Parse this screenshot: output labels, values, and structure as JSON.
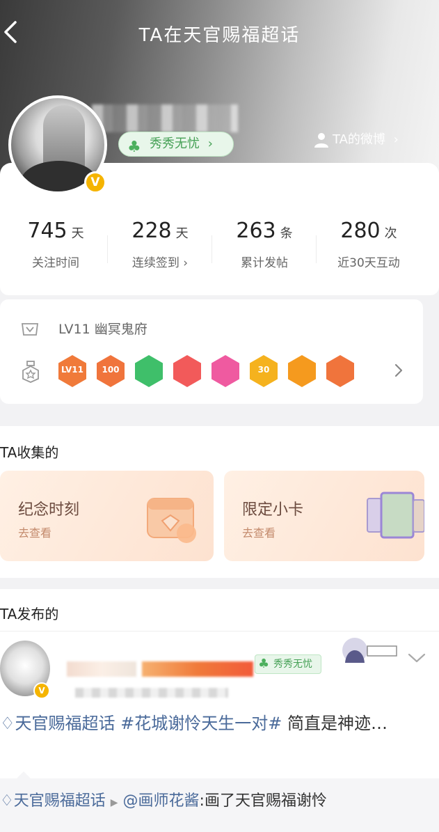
{
  "header": {
    "title": "TA在天官赐福超话",
    "fan_badge": "秀秀无忧",
    "weibo_link": "TA的微博"
  },
  "stats": [
    {
      "value": "745",
      "unit": "天",
      "label": "关注时间"
    },
    {
      "value": "228",
      "unit": "天",
      "label": "连续签到"
    },
    {
      "value": "263",
      "unit": "条",
      "label": "累计发帖"
    },
    {
      "value": "280",
      "unit": "次",
      "label": "近30天互动"
    }
  ],
  "level": {
    "text": "LV11 幽冥鬼府",
    "badges": [
      {
        "name": "lv11-badge",
        "label": "LV11",
        "color": "#f07a3a"
      },
      {
        "name": "100-days-badge",
        "label": "100",
        "color": "#f0743c"
      },
      {
        "name": "hand-badge",
        "label": "",
        "color": "#3fbf6a"
      },
      {
        "name": "trophy-badge",
        "label": "",
        "color": "#f25a5a"
      },
      {
        "name": "cap-badge",
        "label": "",
        "color": "#ef5aa0"
      },
      {
        "name": "30-days-badge",
        "label": "30",
        "color": "#f5b21e"
      },
      {
        "name": "face-badge",
        "label": "",
        "color": "#f59a1e"
      },
      {
        "name": "rock-badge",
        "label": "",
        "color": "#f0743c"
      }
    ]
  },
  "collected": {
    "title": "TA收集的",
    "cards": [
      {
        "title": "纪念时刻",
        "sub": "去查看"
      },
      {
        "title": "限定小卡",
        "sub": "去查看"
      }
    ]
  },
  "posted": {
    "title": "TA发布的",
    "post": {
      "fan_badge": "秀秀无忧",
      "topic": "天官赐福超话",
      "hashtag": "#花城谢怜天生一对#",
      "text": " 简直是神迹…",
      "repost_topic": "天官赐福超话",
      "repost_user": "@画师花酱",
      "repost_text": ":画了天官赐福谢怜"
    }
  },
  "colors": {
    "accent_green": "#45a055",
    "verified_gold": "#f5b400",
    "topic_blue": "#4a6a9a"
  }
}
